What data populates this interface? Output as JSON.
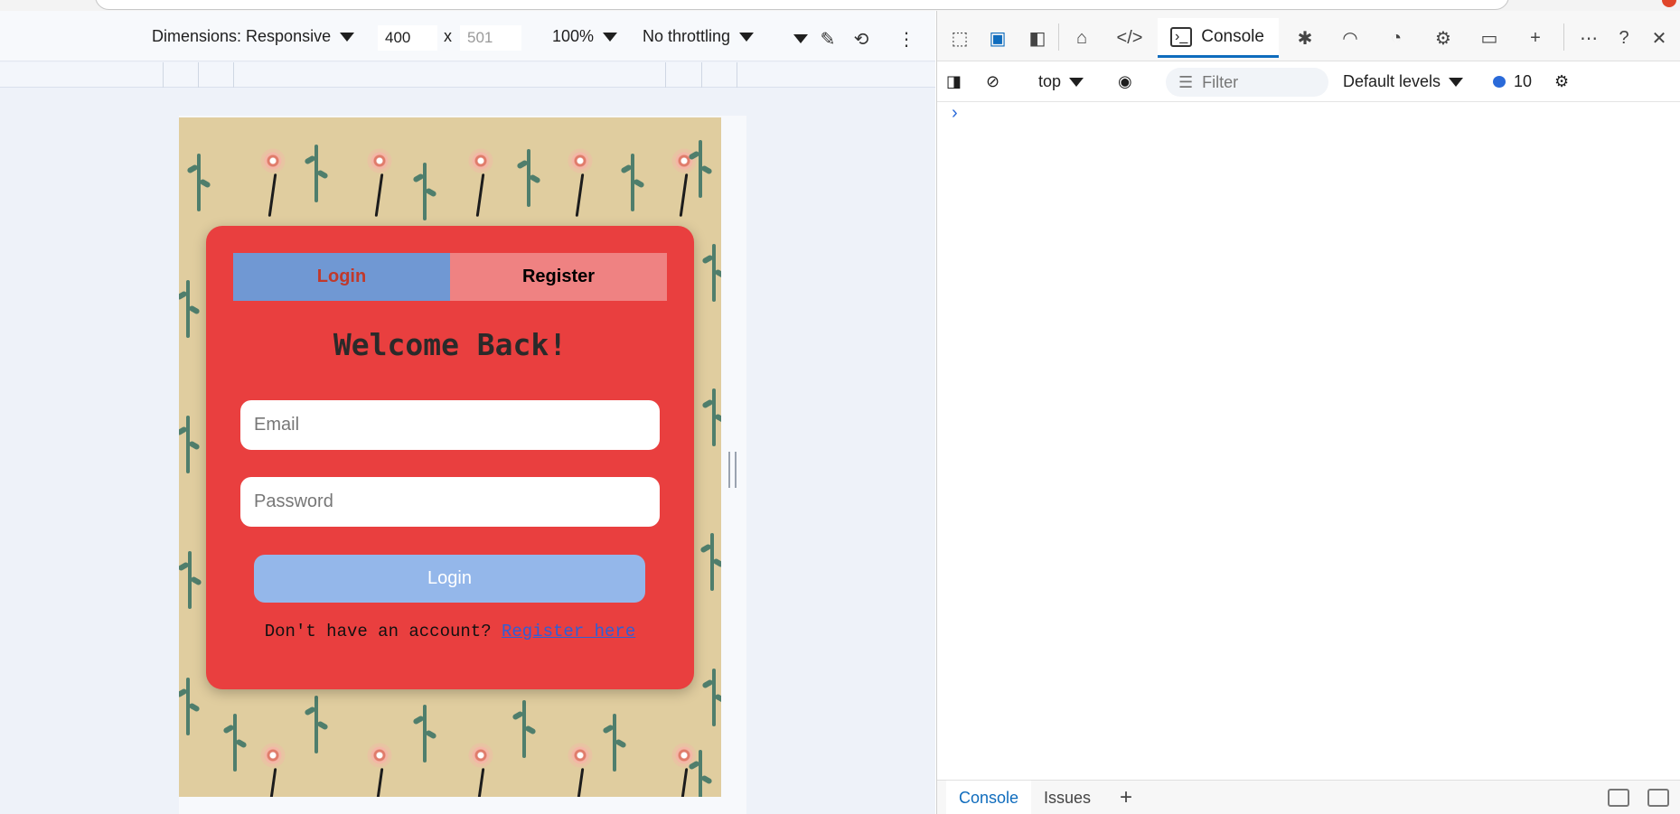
{
  "device_toolbar": {
    "dimensions_label": "Dimensions: Responsive",
    "width_value": "400",
    "times": "x",
    "height_placeholder": "501",
    "zoom": "100%",
    "throttling": "No throttling"
  },
  "app": {
    "tabs": {
      "login": "Login",
      "register": "Register"
    },
    "title": "Welcome Back!",
    "email_placeholder": "Email",
    "password_placeholder": "Password",
    "submit_label": "Login",
    "register_prompt": "Don't have an account?",
    "register_link": "Register here",
    "colors": {
      "card": "#e93f3f",
      "tab_active": "#7098d3",
      "tab_inactive": "#ef8282",
      "button": "#94b7ea",
      "background": "#e0cd9f"
    }
  },
  "devtools": {
    "active_tab": "Console",
    "context": "top",
    "filter_placeholder": "Filter",
    "levels": "Default levels",
    "message_count": "10",
    "prompt": "›",
    "drawer": {
      "console": "Console",
      "issues": "Issues",
      "add": "+"
    }
  }
}
